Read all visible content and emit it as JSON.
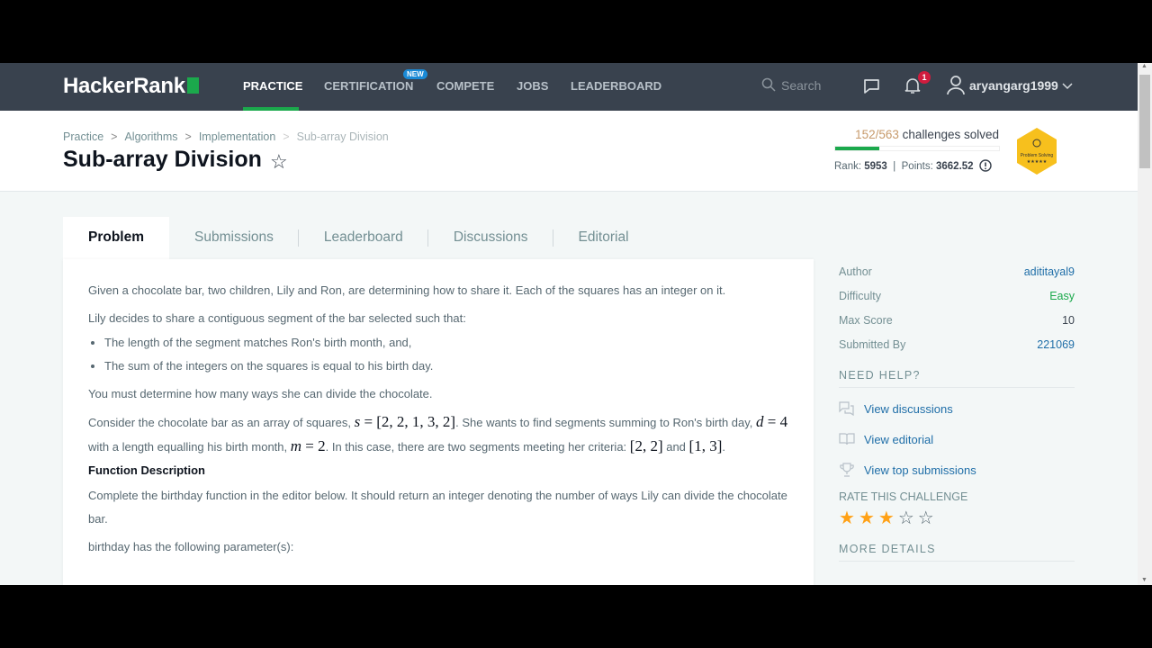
{
  "nav": {
    "logo": "HackerRank",
    "items": [
      "PRACTICE",
      "CERTIFICATION",
      "COMPETE",
      "JOBS",
      "LEADERBOARD"
    ],
    "new_badge": "NEW",
    "search_placeholder": "Search",
    "notifications": "1",
    "username": "aryangarg1999"
  },
  "breadcrumb": [
    "Practice",
    "Algorithms",
    "Implementation",
    "Sub-array Division"
  ],
  "title": "Sub-array Division",
  "progress": {
    "solved": "152/563",
    "label": "challenges solved",
    "fraction": 0.27,
    "rank_label": "Rank:",
    "rank": "5953",
    "points_label": "Points:",
    "points": "3662.52",
    "badge_text": "Problem Solving"
  },
  "tabs": [
    "Problem",
    "Submissions",
    "Leaderboard",
    "Discussions",
    "Editorial"
  ],
  "problem": {
    "p1": "Given a chocolate bar, two children, Lily and Ron, are determining how to share it. Each of the squares has an integer on it.",
    "p2": "Lily decides to share a contiguous segment of the bar selected such that:",
    "bullets": [
      "The length of the segment matches Ron's birth month, and,",
      "The sum of the integers on the squares is equal to his birth day."
    ],
    "p3": "You must determine how many ways she can divide the chocolate.",
    "p4a": "Consider the chocolate bar as an array of squares, ",
    "m1v": "s",
    "m1r": " = [2, 2, 1, 3, 2]",
    "p4b": ". She wants to find segments summing to Ron's birth day, ",
    "m2v": "d",
    "m2r": " = 4",
    "p4c": " with a length equalling his birth month, ",
    "m3v": "m",
    "m3r": " = 2",
    "p4d": ". In this case, there are two segments meeting her criteria: ",
    "m4": "[2, 2]",
    "p4e": " and ",
    "m5": "[1, 3]",
    "p4f": ".",
    "h_func": "Function Description",
    "p5": "Complete the birthday function in the editor below. It should return an integer denoting the number of ways Lily can divide the chocolate bar.",
    "p6": "birthday has the following parameter(s):"
  },
  "sidebar": {
    "details": [
      {
        "k": "Author",
        "v": "adititayal9"
      },
      {
        "k": "Difficulty",
        "v": "Easy"
      },
      {
        "k": "Max Score",
        "v": "10"
      },
      {
        "k": "Submitted By",
        "v": "221069"
      }
    ],
    "need_help": "NEED HELP?",
    "help": [
      "View discussions",
      "View editorial",
      "View top submissions"
    ],
    "rate": "RATE THIS CHALLENGE",
    "rating": 3,
    "rating_max": 5,
    "more": "MORE DETAILS"
  },
  "colors": {
    "nav": "#39424e",
    "green": "#1ba94c",
    "link": "#1f6ea8",
    "easy": "#1ba94c",
    "star": "#ffa116"
  }
}
